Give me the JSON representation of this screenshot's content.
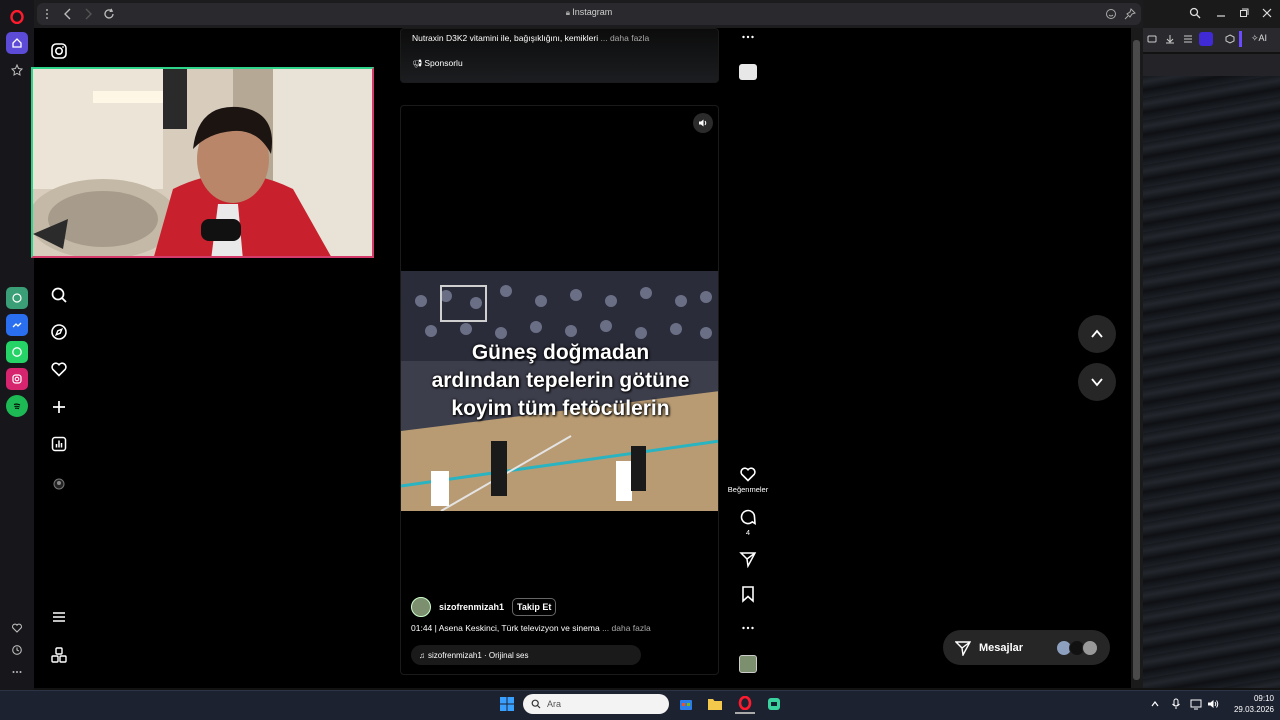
{
  "browser": {
    "url_text": "Instagram",
    "right_window_label": "AI"
  },
  "prev_post": {
    "caption": "Nutraxin D3K2 vitamini ile, bağışıklığını, kemikleri",
    "more": "... daha fazla",
    "sponsored": "Sponsorlu"
  },
  "reel": {
    "video_caption": "Güneş doğmadan ardından tepelerin götüne koyim tüm fetöcülerin",
    "author": "sizofrenmizah1",
    "follow_label": "Takip Et",
    "caption": "01:44 | Asena Keskinci, Türk televizyon ve sinema",
    "more": "... daha fazla",
    "audio": "sizofrenmizah1 · Orijinal ses"
  },
  "actions": {
    "likes_label": "Beğenmeler",
    "comments_count": "4"
  },
  "messages": {
    "label": "Mesajlar"
  },
  "taskbar": {
    "search_placeholder": "Ara",
    "time": "09:10",
    "date": "29.03.2026"
  },
  "colors": {
    "accent_green": "#2ed48a",
    "accent_pink": "#d43a6a",
    "opera_red": "#ff1b2d"
  }
}
